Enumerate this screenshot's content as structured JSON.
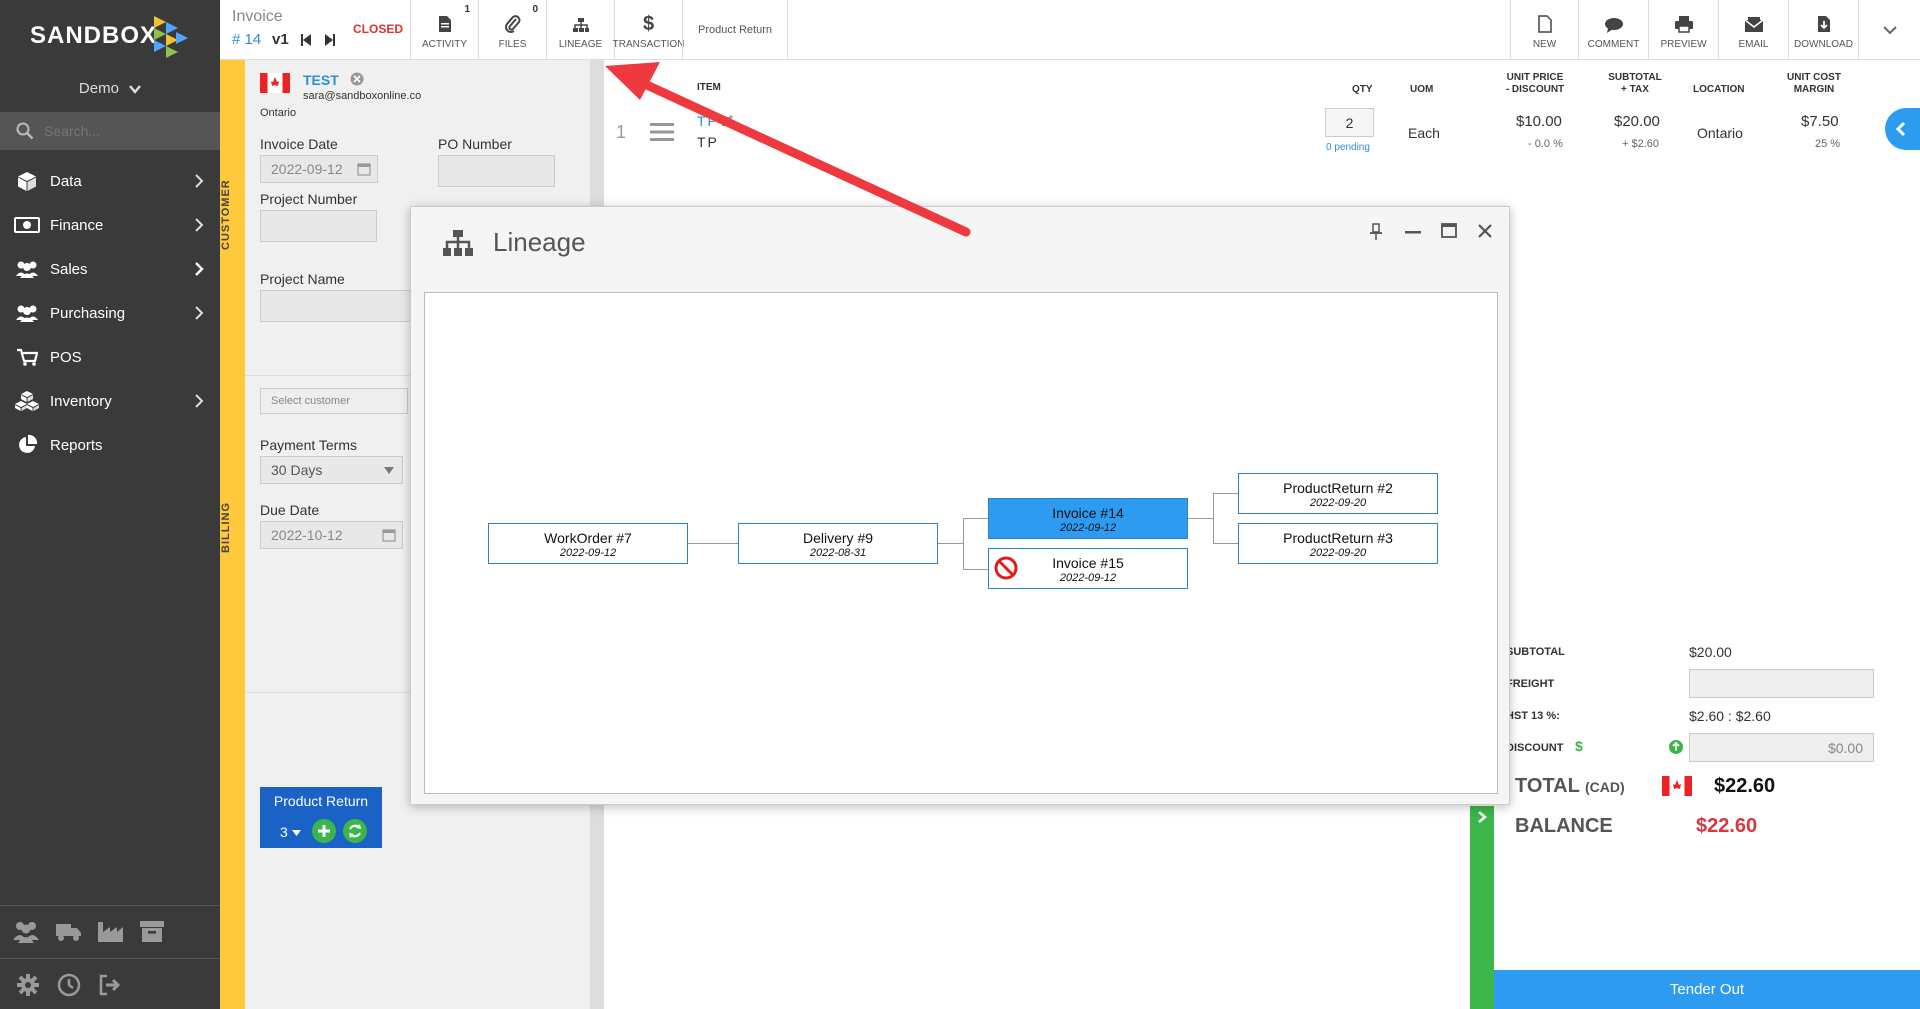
{
  "sidebar": {
    "brand": "SANDBOX",
    "company": "Demo",
    "search_placeholder": "Search...",
    "items": [
      {
        "label": "Data",
        "icon": "cube-icon",
        "chevron": true
      },
      {
        "label": "Finance",
        "icon": "money-icon",
        "chevron": true
      },
      {
        "label": "Sales",
        "icon": "people-icon",
        "chevron": true
      },
      {
        "label": "Purchasing",
        "icon": "people-icon",
        "chevron": true
      },
      {
        "label": "POS",
        "icon": "cart-icon",
        "chevron": false
      },
      {
        "label": "Inventory",
        "icon": "boxes-icon",
        "chevron": true
      },
      {
        "label": "Reports",
        "icon": "pie-chart-icon",
        "chevron": false
      }
    ]
  },
  "header": {
    "doc_type": "Invoice",
    "doc_number": "# 14",
    "version": "v1",
    "status": "CLOSED",
    "activity_label": "ACTIVITY",
    "activity_count": "1",
    "files_label": "FILES",
    "files_count": "0",
    "lineage_label": "LINEAGE",
    "transaction_label": "TRANSACTION",
    "product_return_label": "Product Return",
    "new_label": "NEW",
    "comment_label": "COMMENT",
    "preview_label": "PREVIEW",
    "email_label": "EMAIL",
    "download_label": "DOWNLOAD"
  },
  "customer": {
    "section_label": "CUSTOMER",
    "name": "TEST",
    "email": "sara@sandboxonline.co",
    "region": "Ontario",
    "invoice_date_label": "Invoice Date",
    "invoice_date": "2022-09-12",
    "po_number_label": "PO Number",
    "po_number": "",
    "project_number_label": "Project Number",
    "project_number": "",
    "project_name_label": "Project Name",
    "project_name": ""
  },
  "billing": {
    "section_label": "BILLING",
    "select_customer_placeholder": "Select customer",
    "payment_terms_label": "Payment Terms",
    "payment_terms": "30 Days",
    "due_date_label": "Due Date",
    "due_date": "2022-10-12"
  },
  "related": {
    "label": "Product Return",
    "count": "3"
  },
  "lines": {
    "headers": {
      "item": "ITEM",
      "qty": "QTY",
      "uom": "UOM",
      "unit_price": "UNIT PRICE\n- DISCOUNT",
      "subtotal": "SUBTOTAL\n+ TAX",
      "location": "LOCATION",
      "unit_cost": "UNIT COST\nMARGIN"
    },
    "rows": [
      {
        "index": "1",
        "item_code": "TP",
        "item_name": "TP",
        "qty": "2",
        "pending": "0 pending",
        "uom": "Each",
        "unit_price": "$10.00",
        "discount": "- 0.0 %",
        "subtotal": "$20.00",
        "tax": "+ $2.60",
        "location": "Ontario",
        "unit_cost": "$7.50",
        "margin": "25 %"
      }
    ]
  },
  "totals": {
    "subtotal_label": "SUBTOTAL",
    "subtotal": "$20.00",
    "freight_label": "FREIGHT",
    "freight": "",
    "tax_label": "HST 13 %:",
    "tax": "$2.60 : $2.60",
    "discount_label": "DISCOUNT",
    "discount_symbol": "$",
    "discount": "$0.00",
    "total_label": "TOTAL",
    "currency": "(CAD)",
    "total": "$22.60",
    "balance_label": "BALANCE",
    "balance": "$22.60",
    "tender_label": "Tender Out"
  },
  "modal": {
    "title": "Lineage",
    "nodes": [
      {
        "id": "wo7",
        "label": "WorkOrder #7",
        "date": "2022-09-12",
        "selected": false,
        "void": false
      },
      {
        "id": "dl9",
        "label": "Delivery #9",
        "date": "2022-08-31",
        "selected": false,
        "void": false
      },
      {
        "id": "inv14",
        "label": "Invoice #14",
        "date": "2022-09-12",
        "selected": true,
        "void": false
      },
      {
        "id": "inv15",
        "label": "Invoice #15",
        "date": "2022-09-12",
        "selected": false,
        "void": true
      },
      {
        "id": "pr2",
        "label": "ProductReturn #2",
        "date": "2022-09-20",
        "selected": false,
        "void": false
      },
      {
        "id": "pr3",
        "label": "ProductReturn #3",
        "date": "2022-09-20",
        "selected": false,
        "void": false
      }
    ]
  },
  "colors": {
    "accent": "#2d9bf0",
    "sidebar_bg": "#3a3a3a",
    "strip": "#ffc93c",
    "status_closed": "#dd3333",
    "balance": "#d9363e",
    "arrow": "#ee3a3f",
    "green": "#3cb64a"
  }
}
